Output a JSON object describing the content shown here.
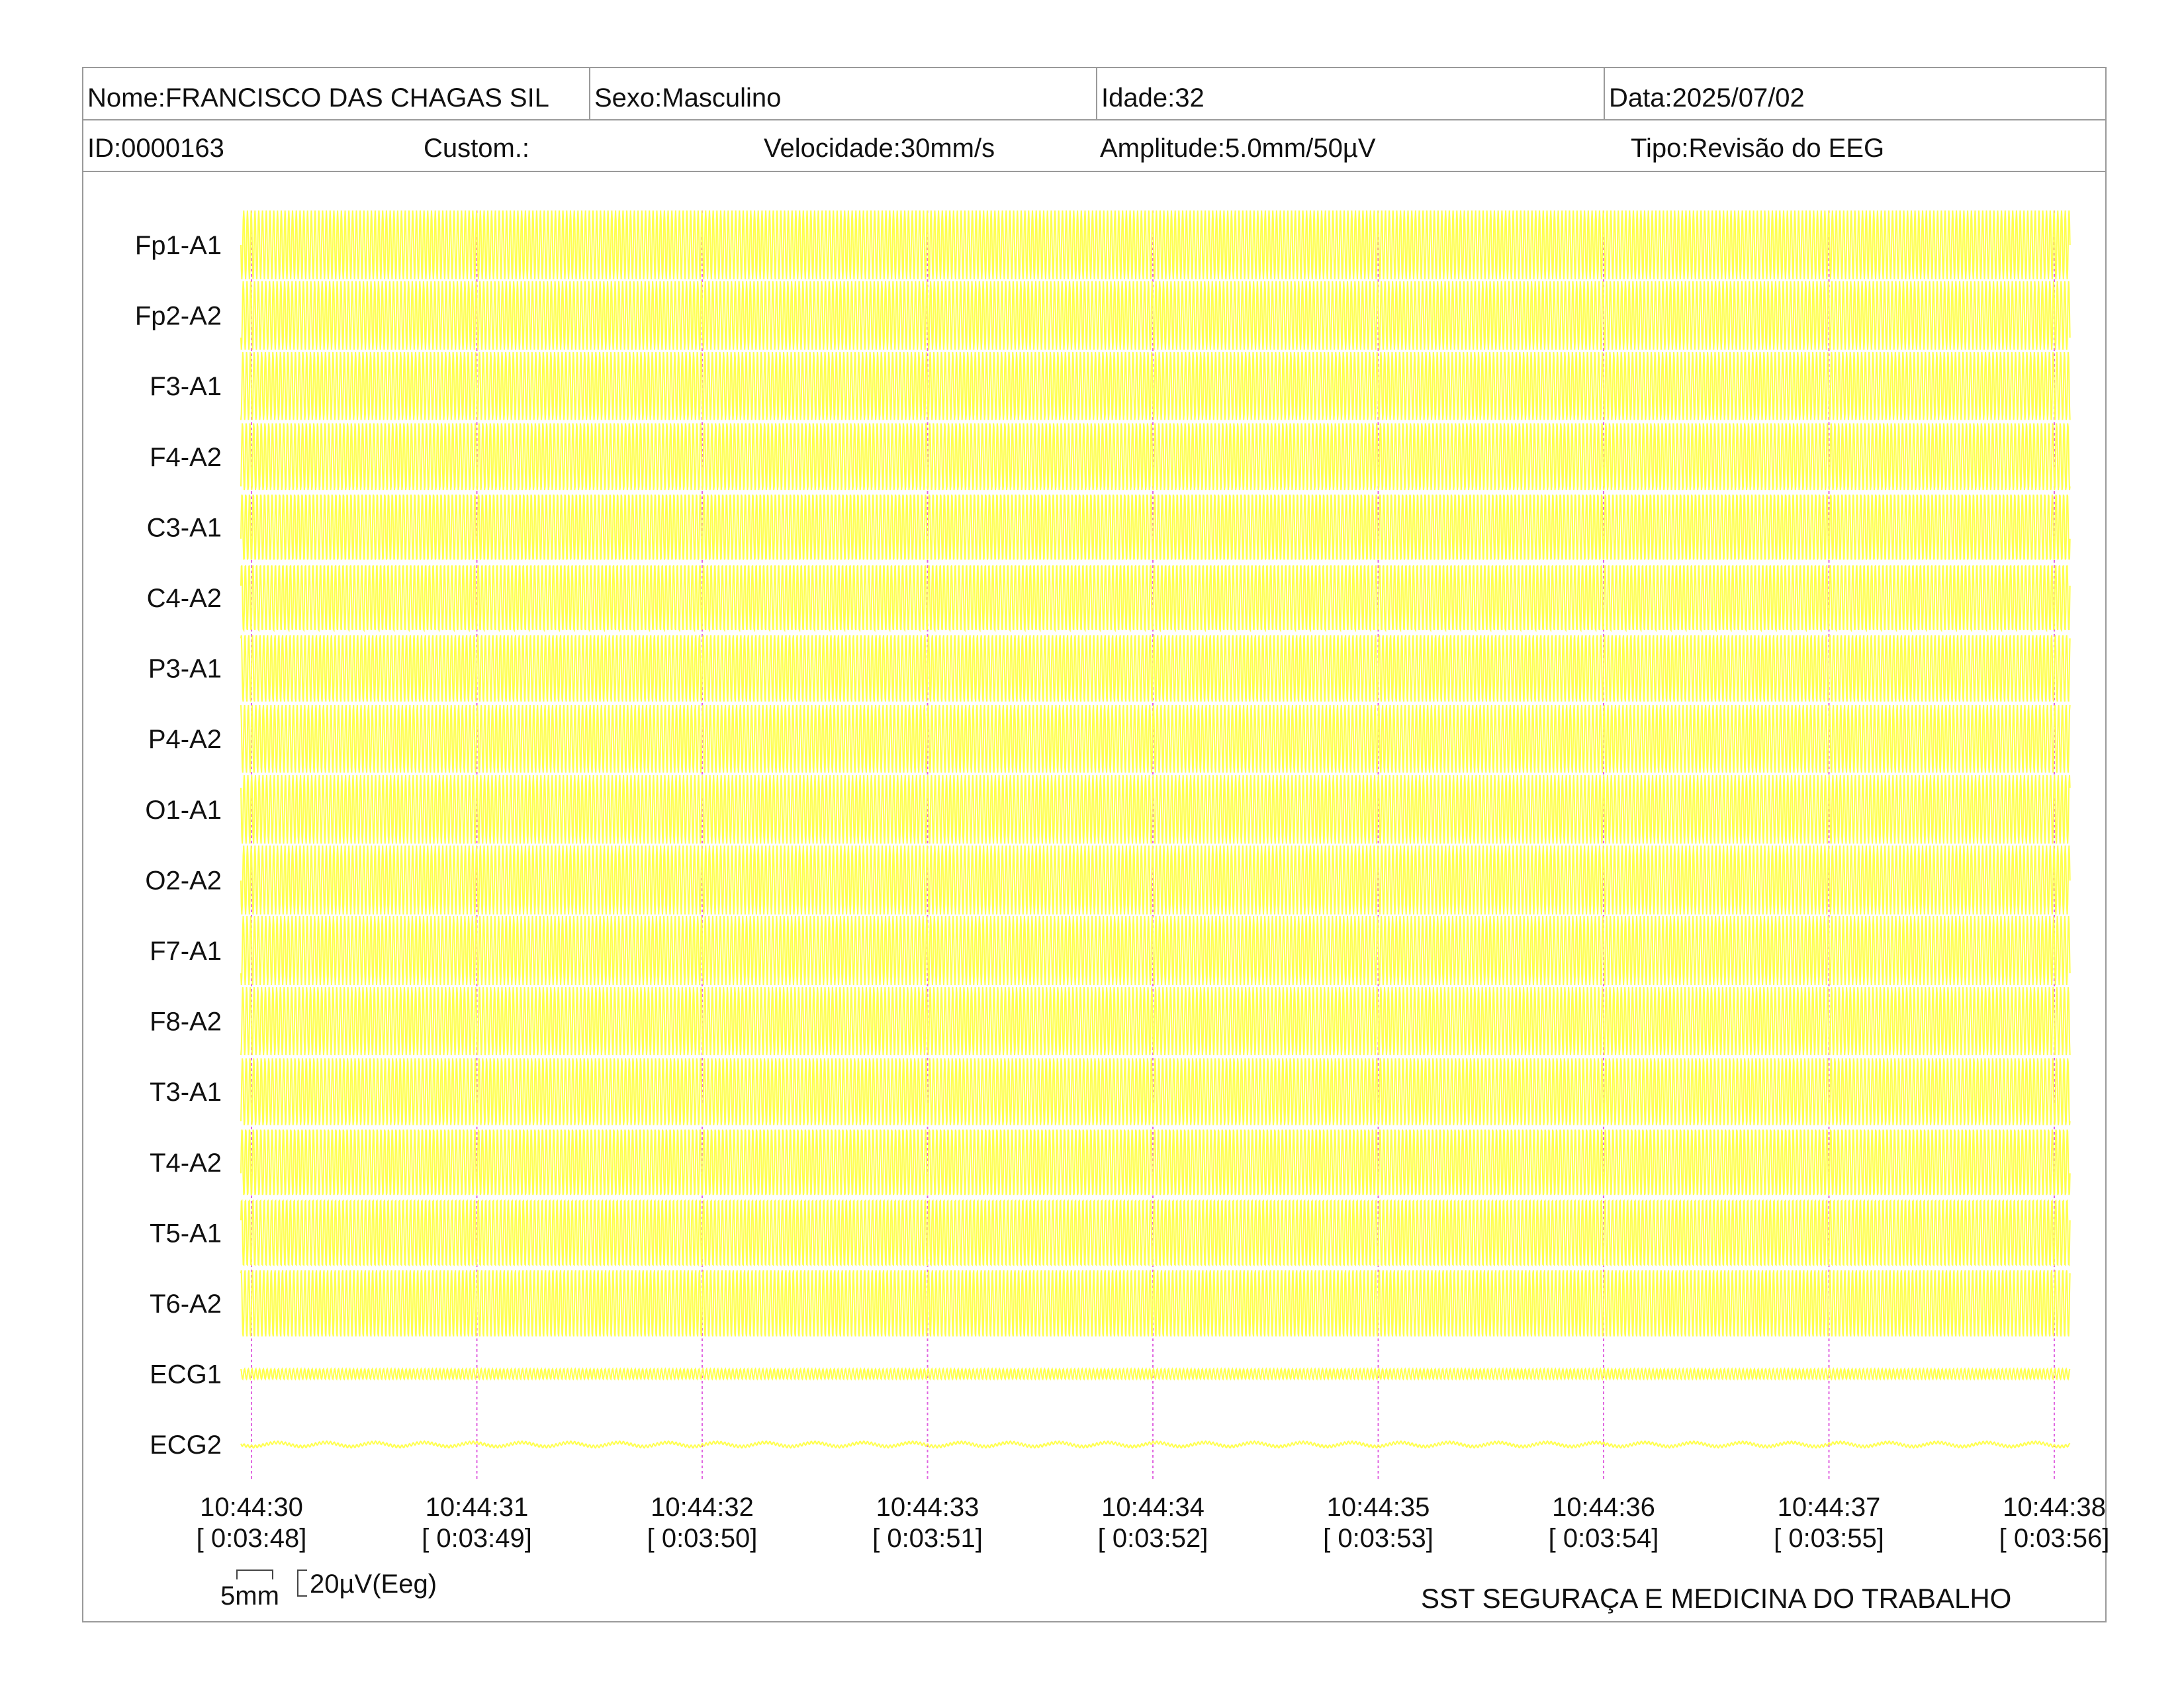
{
  "header": {
    "nome": "Nome:FRANCISCO DAS CHAGAS SIL",
    "sexo": "Sexo:Masculino",
    "idade": "Idade:32",
    "data": "Data:2025/07/02",
    "id": "ID:0000163",
    "custom": "Custom.:",
    "velocidade": "Velocidade:30mm/s",
    "amplitude": "Amplitude:5.0mm/50µV",
    "tipo": "Tipo:Revisão do EEG"
  },
  "chart_data": {
    "type": "line",
    "title": "",
    "channels": [
      "Fp1-A1",
      "Fp2-A2",
      "F3-A1",
      "F4-A2",
      "C3-A1",
      "C4-A2",
      "P3-A1",
      "P4-A2",
      "O1-A1",
      "O2-A2",
      "F7-A1",
      "F8-A2",
      "T3-A1",
      "T4-A2",
      "T5-A1",
      "T6-A2",
      "ECG1",
      "ECG2"
    ],
    "time_ticks": [
      "10:44:30",
      "10:44:31",
      "10:44:32",
      "10:44:33",
      "10:44:34",
      "10:44:35",
      "10:44:36",
      "10:44:37",
      "10:44:38"
    ],
    "elapsed_ticks": [
      "[ 0:03:48]",
      "[ 0:03:49]",
      "[ 0:03:50]",
      "[ 0:03:51]",
      "[ 0:03:52]",
      "[ 0:03:53]",
      "[ 0:03:54]",
      "[ 0:03:55]",
      "[ 0:03:56]"
    ],
    "trace_color": "#ffff4d",
    "marker_color": "#e066e0",
    "approx_frequency_hz": 60,
    "relative_amplitude": [
      1,
      1,
      1,
      1,
      1,
      1,
      1,
      1,
      1,
      1,
      1,
      1,
      1,
      1,
      1,
      1,
      0.15,
      0.04
    ],
    "time_range_s": [
      0,
      8
    ]
  },
  "scale": {
    "time_label": "5mm",
    "amp_label": "20µV(Eeg)"
  },
  "footer": {
    "company": "SST SEGURAÇA E MEDICINA DO TRABALHO"
  }
}
